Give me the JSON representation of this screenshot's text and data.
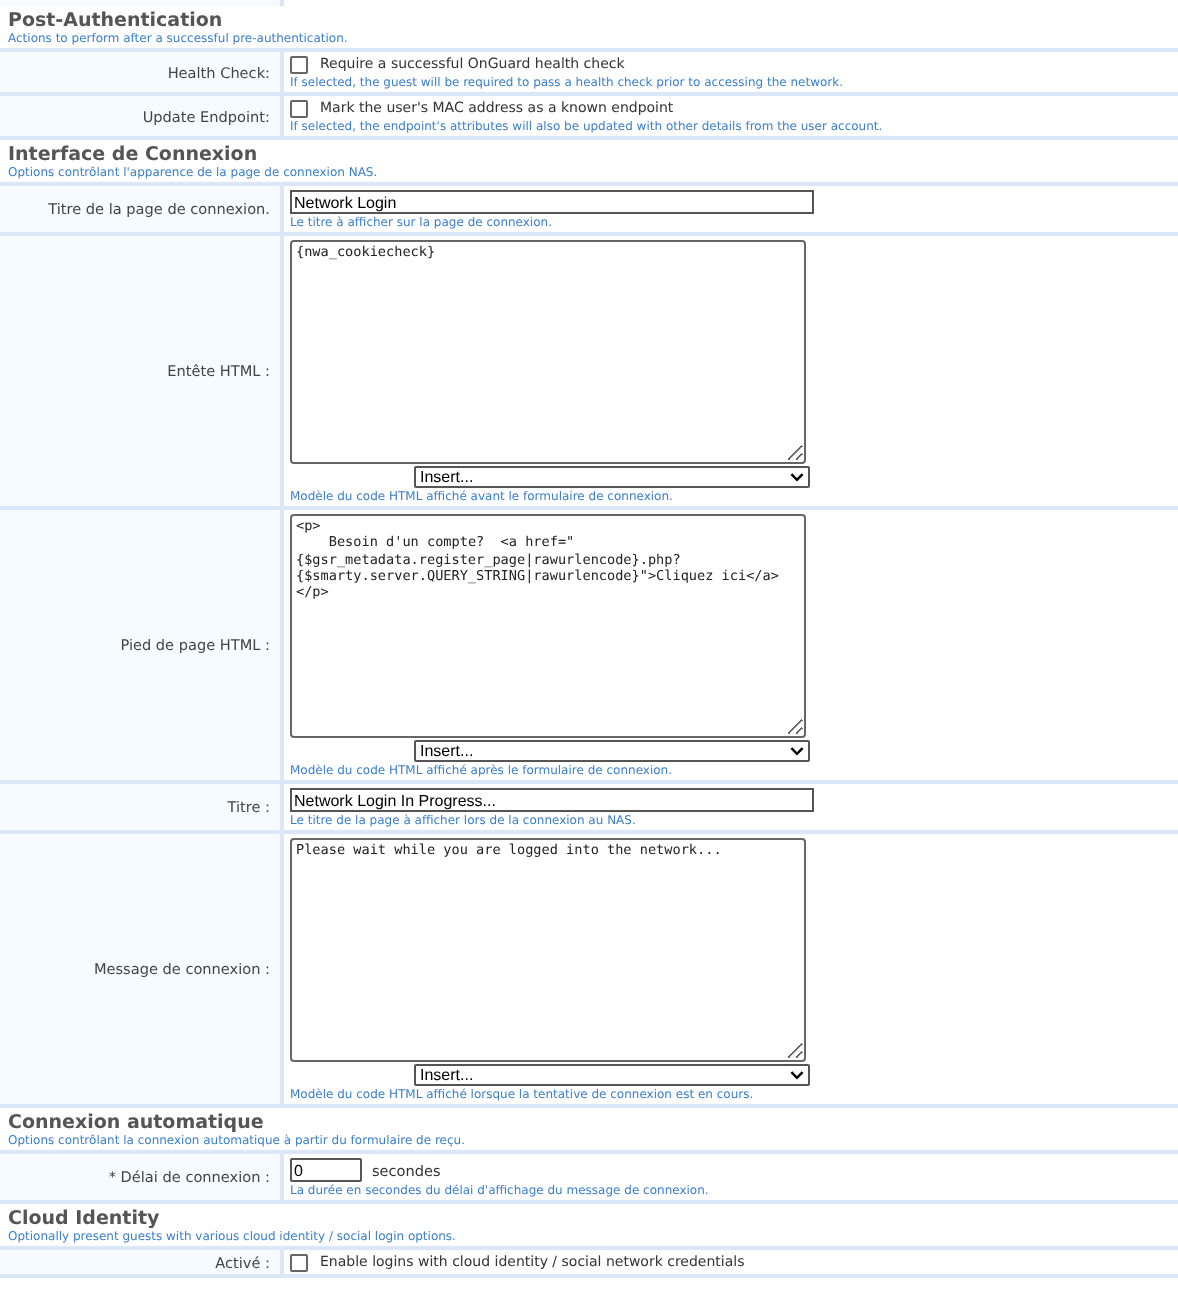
{
  "sections": [
    {
      "title": "Post-Authentication",
      "subtitle": "Actions to perform after a successful pre-authentication.",
      "rows": [
        {
          "kind": "checkbox",
          "label": "Health Check:",
          "checked": false,
          "text": "Require a successful OnGuard health check",
          "hint": "If selected, the guest will be required to pass a health check prior to accessing the network."
        },
        {
          "kind": "checkbox",
          "label": "Update Endpoint:",
          "checked": false,
          "text": "Mark the user's MAC address as a known endpoint",
          "hint": "If selected, the endpoint's attributes will also be updated with other details from the user account."
        }
      ]
    },
    {
      "title": "Interface de Connexion",
      "subtitle": "Options contrôlant l'apparence de la page de connexion NAS.",
      "rows": [
        {
          "kind": "text",
          "label": "Titre de la page de connexion.",
          "value": "Network Login",
          "hint": "Le titre à afficher sur la page de connexion."
        },
        {
          "kind": "textarea",
          "label": "Entête HTML :",
          "value": "{nwa_cookiecheck}",
          "select": "Insert...",
          "hint": "Modèle du code HTML affiché avant le formulaire de connexion."
        },
        {
          "kind": "textarea",
          "label": "Pied de page HTML :",
          "value": "<p>\n    Besoin d'un compte?  <a href=\"\n{$gsr_metadata.register_page|rawurlencode}.php?\n{$smarty.server.QUERY_STRING|rawurlencode}\">Cliquez ici</a>\n</p>",
          "select": "Insert...",
          "hint": "Modèle du code HTML affiché après le formulaire de connexion."
        },
        {
          "kind": "text",
          "label": "Titre :",
          "value": "Network Login In Progress...",
          "hint": "Le titre de la page à afficher lors de la connexion au NAS."
        },
        {
          "kind": "textarea",
          "label": "Message de connexion :",
          "value": "Please wait while you are logged into the network...",
          "select": "Insert...",
          "hint": "Modèle du code HTML affiché lorsque la tentative de connexion est en cours."
        }
      ]
    },
    {
      "title": "Connexion automatique",
      "subtitle": "Options contrôlant la connexion automatique à partir du formulaire de reçu.",
      "rows": [
        {
          "kind": "number",
          "required": "*",
          "label": "Délai de connexion :",
          "value": "0",
          "unit": "secondes",
          "hint": "La durée en secondes du délai d'affichage du message de connexion."
        }
      ]
    },
    {
      "title": "Cloud Identity",
      "subtitle": "Optionally present guests with various cloud identity / social login options.",
      "rows": [
        {
          "kind": "checkbox",
          "label": "Activé :",
          "checked": false,
          "text": "Enable logins with cloud identity / social network credentials"
        }
      ]
    }
  ]
}
